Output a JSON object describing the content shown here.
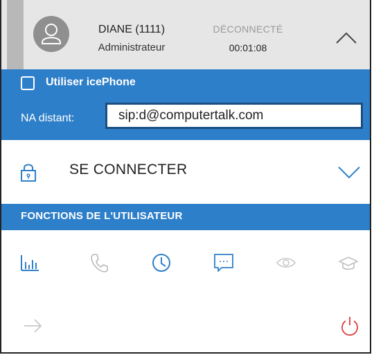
{
  "header": {
    "user_name": "DIANE (1111)",
    "user_role": "Administrateur",
    "status": "DÉCONNECTÉ",
    "timer": "00:01:08",
    "avatar_icon": "user-icon",
    "collapse_icon": "chevron-up-icon"
  },
  "phone_settings": {
    "use_icephone_label": "Utiliser icePhone",
    "use_icephone_checked": false,
    "remote_na_label": "NA distant:",
    "remote_na_value": "sip:d@computertalk.com"
  },
  "connect": {
    "label": "SE CONNECTER",
    "lock_icon": "lock-icon",
    "expand_icon": "chevron-down-icon"
  },
  "user_functions": {
    "section_title": "FONCTIONS DE L'UTILISATEUR",
    "icons": [
      "bar-chart-icon",
      "phone-icon",
      "clock-icon",
      "chat-icon",
      "eye-icon",
      "graduation-cap-icon",
      "arrow-right-icon",
      "power-icon"
    ]
  },
  "colors": {
    "accent": "#2e7fc9",
    "header_bg": "#e6e6e6",
    "power_red": "#e03a3a",
    "icon_grey": "#c4c4c4"
  }
}
